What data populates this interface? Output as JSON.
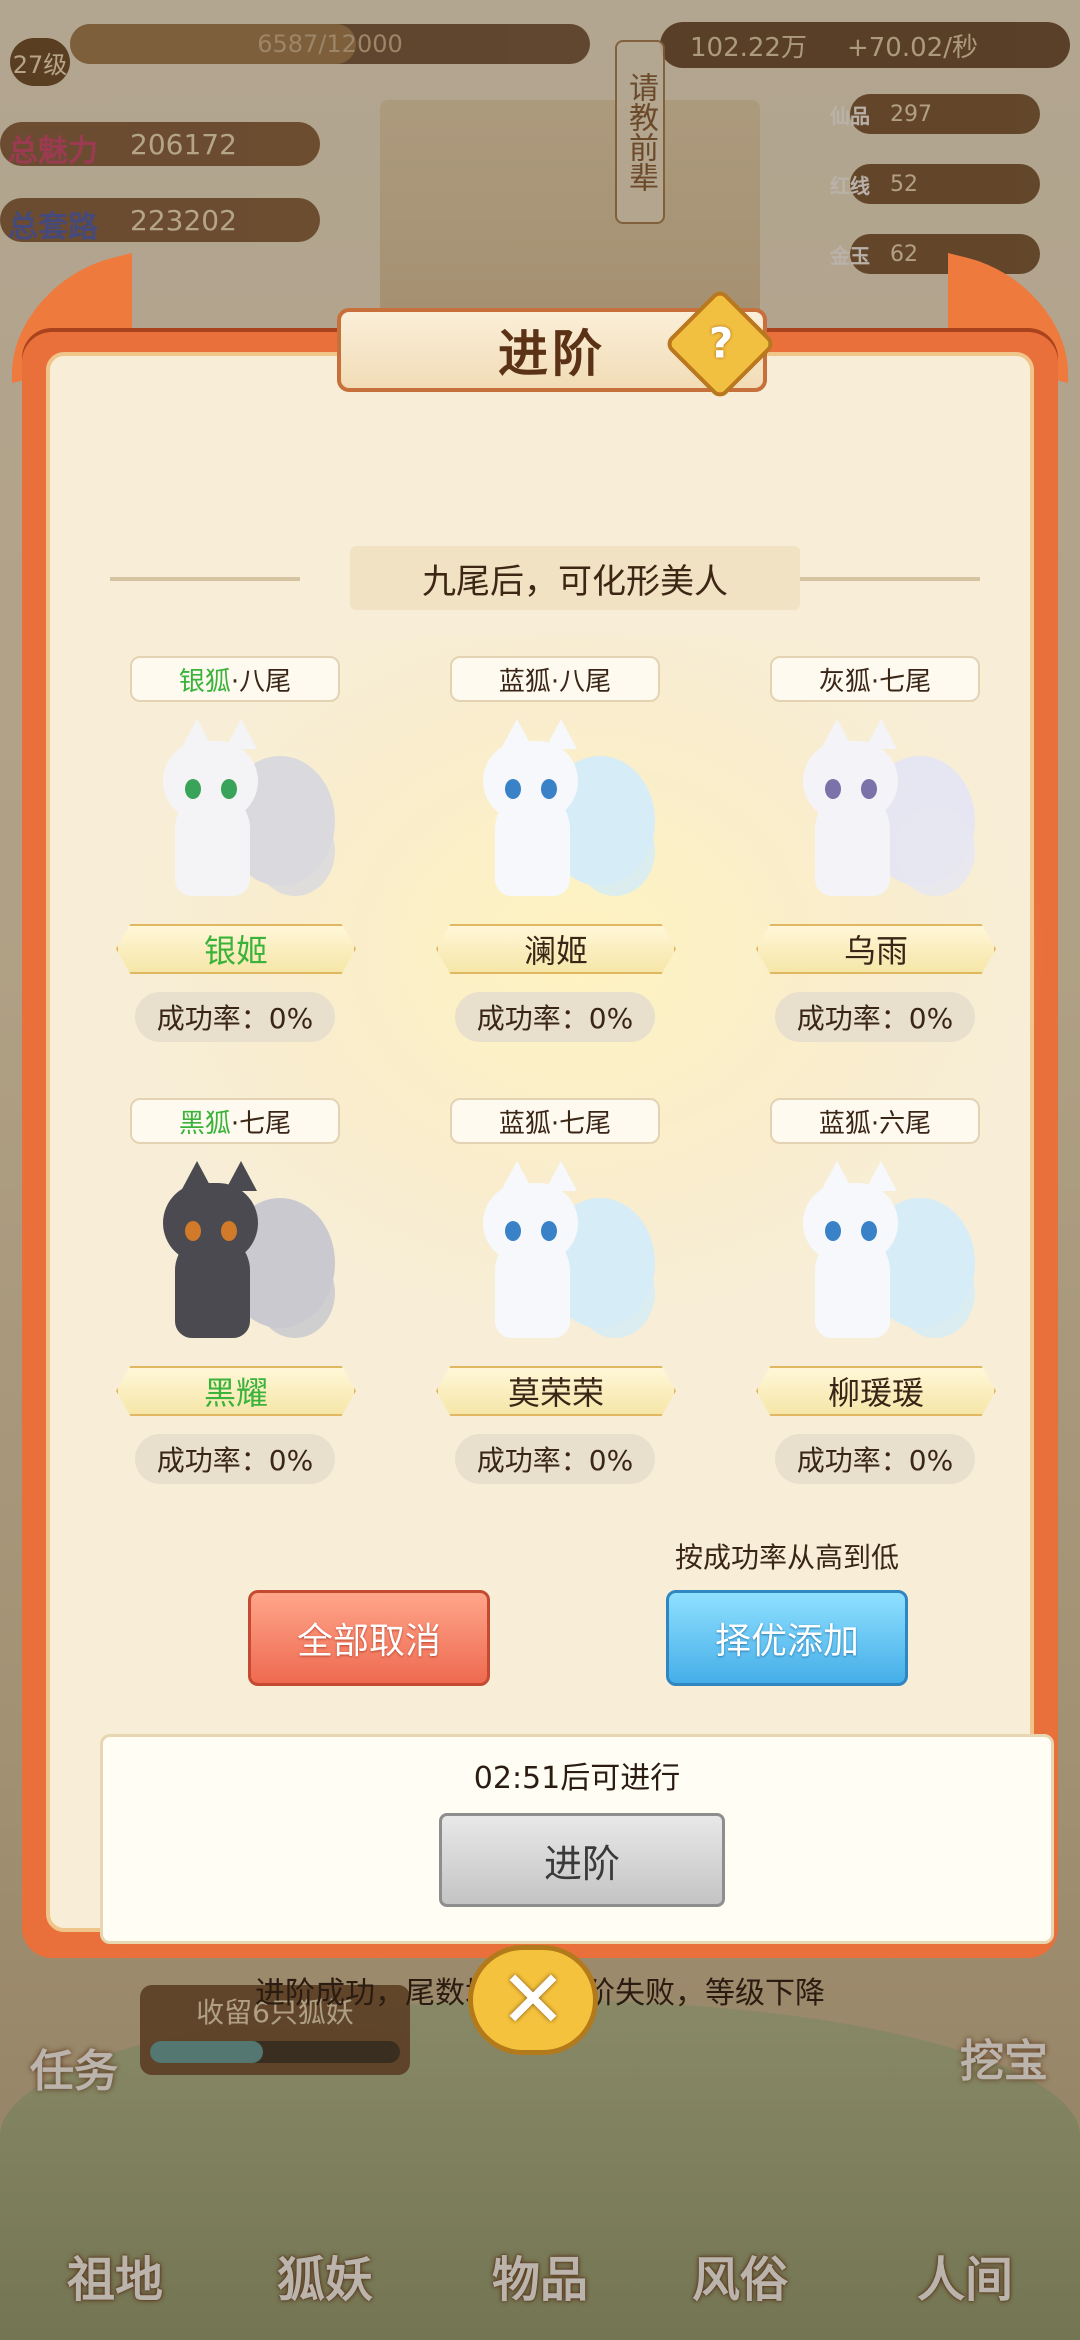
{
  "hud": {
    "level": "27级",
    "exp": "6587/12000",
    "exp_progress": 0.55,
    "charm_label": "总魅力",
    "charm_value": "206172",
    "route_label": "总套路",
    "route_value": "223202",
    "currency": "102.22万",
    "rate": "+70.02/秒",
    "side_banner": "请教前辈",
    "resources": [
      {
        "icon": "仙品",
        "value": "297"
      },
      {
        "icon": "红线",
        "value": "52"
      },
      {
        "icon": "金玉",
        "value": "62"
      }
    ]
  },
  "dialog": {
    "title": "进阶",
    "help": "?",
    "subtitle": "九尾后，可化形美人",
    "cards": [
      {
        "color": "银狐",
        "tail": "·八尾",
        "color_green": true,
        "name": "银姬",
        "name_green": true,
        "rate": "成功率：0%",
        "fur": "#f4f4f6",
        "eye": "#3aa35a",
        "tail_color": "#d9d9de"
      },
      {
        "color": "蓝狐",
        "tail": "·八尾",
        "color_green": false,
        "name": "澜姬",
        "name_green": false,
        "rate": "成功率：0%",
        "fur": "#f6f8fc",
        "eye": "#3a82c8",
        "tail_color": "#d6ecf6"
      },
      {
        "color": "灰狐",
        "tail": "·七尾",
        "color_green": false,
        "name": "乌雨",
        "name_green": false,
        "rate": "成功率：0%",
        "fur": "#f4f3f8",
        "eye": "#7a72a8",
        "tail_color": "#e6e6f2"
      },
      {
        "color": "黑狐",
        "tail": "·七尾",
        "color_green": true,
        "name": "黑耀",
        "name_green": true,
        "rate": "成功率：0%",
        "fur": "#4a4a50",
        "eye": "#d07a2a",
        "tail_color": "#c9c9cf"
      },
      {
        "color": "蓝狐",
        "tail": "·七尾",
        "color_green": false,
        "name": "莫荣荣",
        "name_green": false,
        "rate": "成功率：0%",
        "fur": "#f6f8fc",
        "eye": "#3a82c8",
        "tail_color": "#d6ecf6"
      },
      {
        "color": "蓝狐",
        "tail": "·六尾",
        "color_green": false,
        "name": "柳瑗瑗",
        "name_green": false,
        "rate": "成功率：0%",
        "fur": "#f6f8fc",
        "eye": "#3a82c8",
        "tail_color": "#d6ecf6"
      }
    ],
    "cancel_all": "全部取消",
    "best_hint": "按成功率从高到低",
    "best_add": "择优添加",
    "timer": "02:51后可进行",
    "advance_button": "进阶",
    "footer_note": "进阶成功，尾数增加，进阶失败，等级下降"
  },
  "bottom": {
    "recruit_text": "收留6只狐妖",
    "recruit_progress": 0.45,
    "task": "任务",
    "treasure": "挖宝",
    "nav": [
      "祖地",
      "狐妖",
      "物品",
      "风俗",
      "人间"
    ]
  },
  "colors": {
    "frame": "#e9703a",
    "green_text": "#3bb33b",
    "cancel": "#ee6a50",
    "best": "#45aee8"
  }
}
